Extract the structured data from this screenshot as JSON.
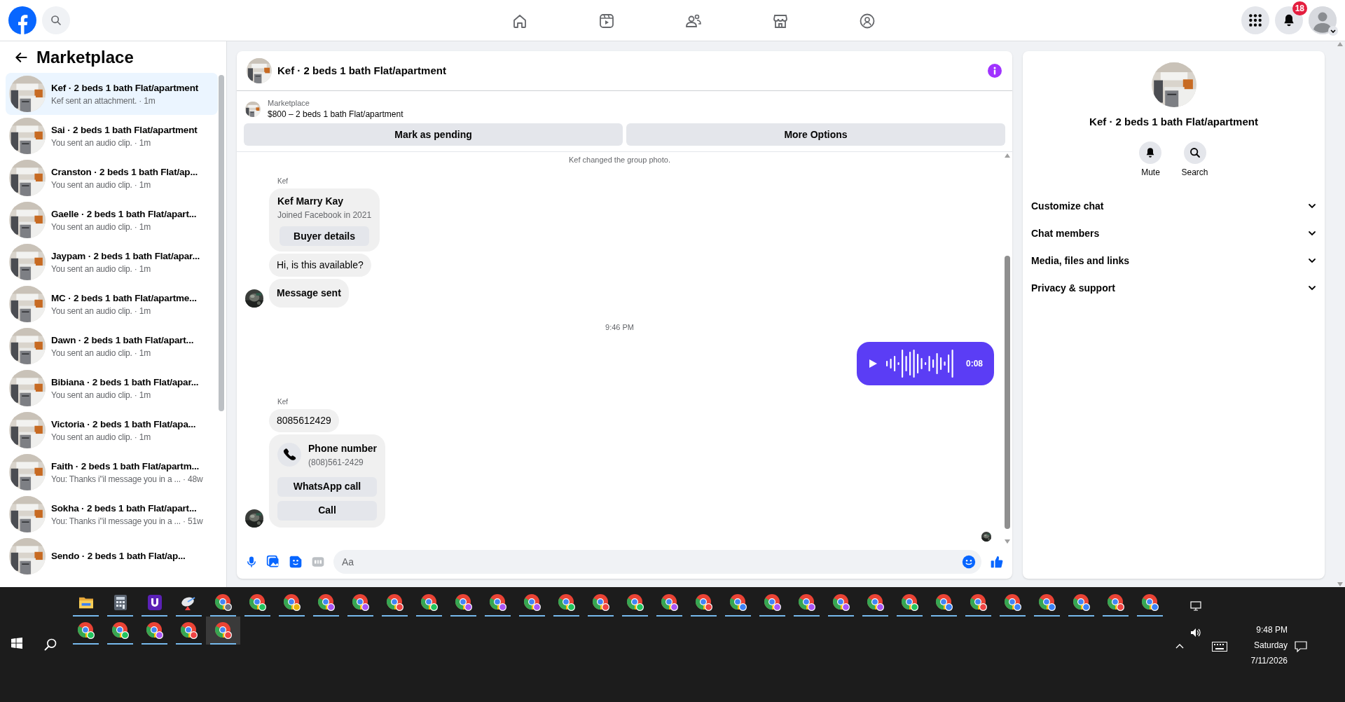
{
  "top_bar": {
    "notification_count": "18"
  },
  "sidebar": {
    "title": "Marketplace",
    "conversations": [
      {
        "name": "Kef · 2 beds 1 bath Flat/apartment",
        "preview": "Kef sent an attachment. · 1m",
        "selected": true
      },
      {
        "name": "Sai · 2 beds 1 bath Flat/apartment",
        "preview": "You sent an audio clip. · 1m",
        "selected": false
      },
      {
        "name": "Cranston · 2 beds 1 bath Flat/ap...",
        "preview": "You sent an audio clip. · 1m",
        "selected": false
      },
      {
        "name": "Gaelle · 2 beds 1 bath Flat/apart...",
        "preview": "You sent an audio clip. · 1m",
        "selected": false
      },
      {
        "name": "Jaypam · 2 beds 1 bath Flat/apar...",
        "preview": "You sent an audio clip. · 1m",
        "selected": false
      },
      {
        "name": "MC · 2 beds 1 bath Flat/apartme...",
        "preview": "You sent an audio clip. · 1m",
        "selected": false
      },
      {
        "name": "Dawn · 2 beds 1 bath Flat/apart...",
        "preview": "You sent an audio clip. · 1m",
        "selected": false
      },
      {
        "name": "Bibiana · 2 beds 1 bath Flat/apar...",
        "preview": "You sent an audio clip. · 1m",
        "selected": false
      },
      {
        "name": "Victoria · 2 beds 1 bath Flat/apa...",
        "preview": "You sent an audio clip. · 1m",
        "selected": false
      },
      {
        "name": "Faith · 2 beds 1 bath Flat/apartm...",
        "preview": "You: Thanks i\"il message you in a ... · 48w",
        "selected": false
      },
      {
        "name": "Sokha · 2 beds 1 bath Flat/apart...",
        "preview": "You: Thanks i\"il message you in a ... · 51w",
        "selected": false
      },
      {
        "name": "Sendo · 2 beds 1 bath Flat/ap...",
        "selected": false
      }
    ]
  },
  "chat": {
    "title": "Kef · 2 beds 1 bath Flat/apartment",
    "listing": {
      "label": "Marketplace",
      "text": "$800 – 2 beds 1 bath Flat/apartment"
    },
    "actions": [
      "Mark as pending",
      "More Options"
    ],
    "messages": [
      {
        "kind": "system",
        "text": "Kef changed the group photo."
      },
      {
        "kind": "sender",
        "text": "Kef"
      },
      {
        "kind": "profile_card",
        "name": "Kef Marry Kay",
        "detail": "Joined Facebook in 2021",
        "button": "Buyer details",
        "avatar": false
      },
      {
        "kind": "text",
        "text": "Hi, is this available?",
        "avatar": false
      },
      {
        "kind": "notice",
        "text": "Message sent",
        "avatar": true
      },
      {
        "kind": "time",
        "text": "9:46 PM"
      },
      {
        "kind": "audio",
        "duration": "0:08"
      },
      {
        "kind": "sender",
        "text": "Kef"
      },
      {
        "kind": "text",
        "text": "8085612429",
        "avatar": false
      },
      {
        "kind": "contact_card",
        "title": "Phone number",
        "detail": "(808)561-2429",
        "buttons": [
          "WhatsApp call",
          "Call"
        ],
        "avatar": true
      }
    ],
    "composer": {
      "placeholder": "Aa"
    }
  },
  "details": {
    "title": "Kef · 2 beds 1 bath Flat/apartment",
    "actions": [
      {
        "label": "Mute",
        "kind": "bell"
      },
      {
        "label": "Search",
        "kind": "search"
      }
    ],
    "sections": [
      "Customize chat",
      "Chat members",
      "Media, files and links",
      "Privacy & support"
    ]
  },
  "taskbar": {
    "items": [
      {
        "kind": "folder",
        "selected": false
      },
      {
        "kind": "calculator",
        "selected": false
      },
      {
        "kind": "app",
        "selected": false
      },
      {
        "kind": "dish",
        "selected": false
      },
      {
        "kind": "browser",
        "color": "#6b7280",
        "selected": false
      },
      {
        "kind": "browser",
        "color": "#22c55e",
        "selected": false
      },
      {
        "kind": "browser",
        "color": "#eab308",
        "selected": false
      },
      {
        "kind": "browser",
        "color": "#a855f7",
        "selected": false
      },
      {
        "kind": "browser",
        "color": "#a855f7",
        "selected": false
      },
      {
        "kind": "browser",
        "color": "#ef4444",
        "selected": false
      },
      {
        "kind": "browser",
        "color": "#22c55e",
        "selected": false
      },
      {
        "kind": "browser",
        "color": "#a855f7",
        "selected": false
      },
      {
        "kind": "browser",
        "color": "#a855f7",
        "selected": false
      },
      {
        "kind": "browser",
        "color": "#a855f7",
        "selected": false
      },
      {
        "kind": "browser",
        "color": "#22c55e",
        "selected": false
      },
      {
        "kind": "browser",
        "color": "#ef4444",
        "selected": false
      },
      {
        "kind": "browser",
        "color": "#22c55e",
        "selected": false
      },
      {
        "kind": "browser",
        "color": "#a855f7",
        "selected": false
      },
      {
        "kind": "browser",
        "color": "#ef4444",
        "selected": false
      },
      {
        "kind": "browser",
        "color": "#3b82f6",
        "selected": false
      },
      {
        "kind": "browser",
        "color": "#a855f7",
        "selected": false
      },
      {
        "kind": "browser",
        "color": "#a855f7",
        "selected": false
      },
      {
        "kind": "browser",
        "color": "#a855f7",
        "selected": false
      },
      {
        "kind": "browser",
        "color": "#a855f7",
        "selected": false
      },
      {
        "kind": "browser",
        "color": "#22c55e",
        "selected": false
      },
      {
        "kind": "browser",
        "color": "#3b82f6",
        "selected": false
      },
      {
        "kind": "browser",
        "color": "#ef4444",
        "selected": false
      },
      {
        "kind": "browser",
        "color": "#3b82f6",
        "selected": false
      },
      {
        "kind": "browser",
        "color": "#3b82f6",
        "selected": false
      },
      {
        "kind": "browser",
        "color": "#3b82f6",
        "selected": false
      },
      {
        "kind": "browser",
        "color": "#ef4444",
        "selected": false
      },
      {
        "kind": "browser",
        "color": "#3b82f6",
        "selected": false
      },
      {
        "kind": "browser",
        "color": "#22c55e",
        "selected": false
      },
      {
        "kind": "browser",
        "color": "#22c55e",
        "selected": false
      },
      {
        "kind": "browser",
        "color": "#a855f7",
        "selected": false
      },
      {
        "kind": "browser",
        "color": "#ef4444",
        "selected": false
      },
      {
        "kind": "browser",
        "color": "#ef4444",
        "selected": true
      }
    ],
    "clock": {
      "time": "9:48 PM",
      "day": "Saturday",
      "date": "7/11/2026"
    }
  }
}
